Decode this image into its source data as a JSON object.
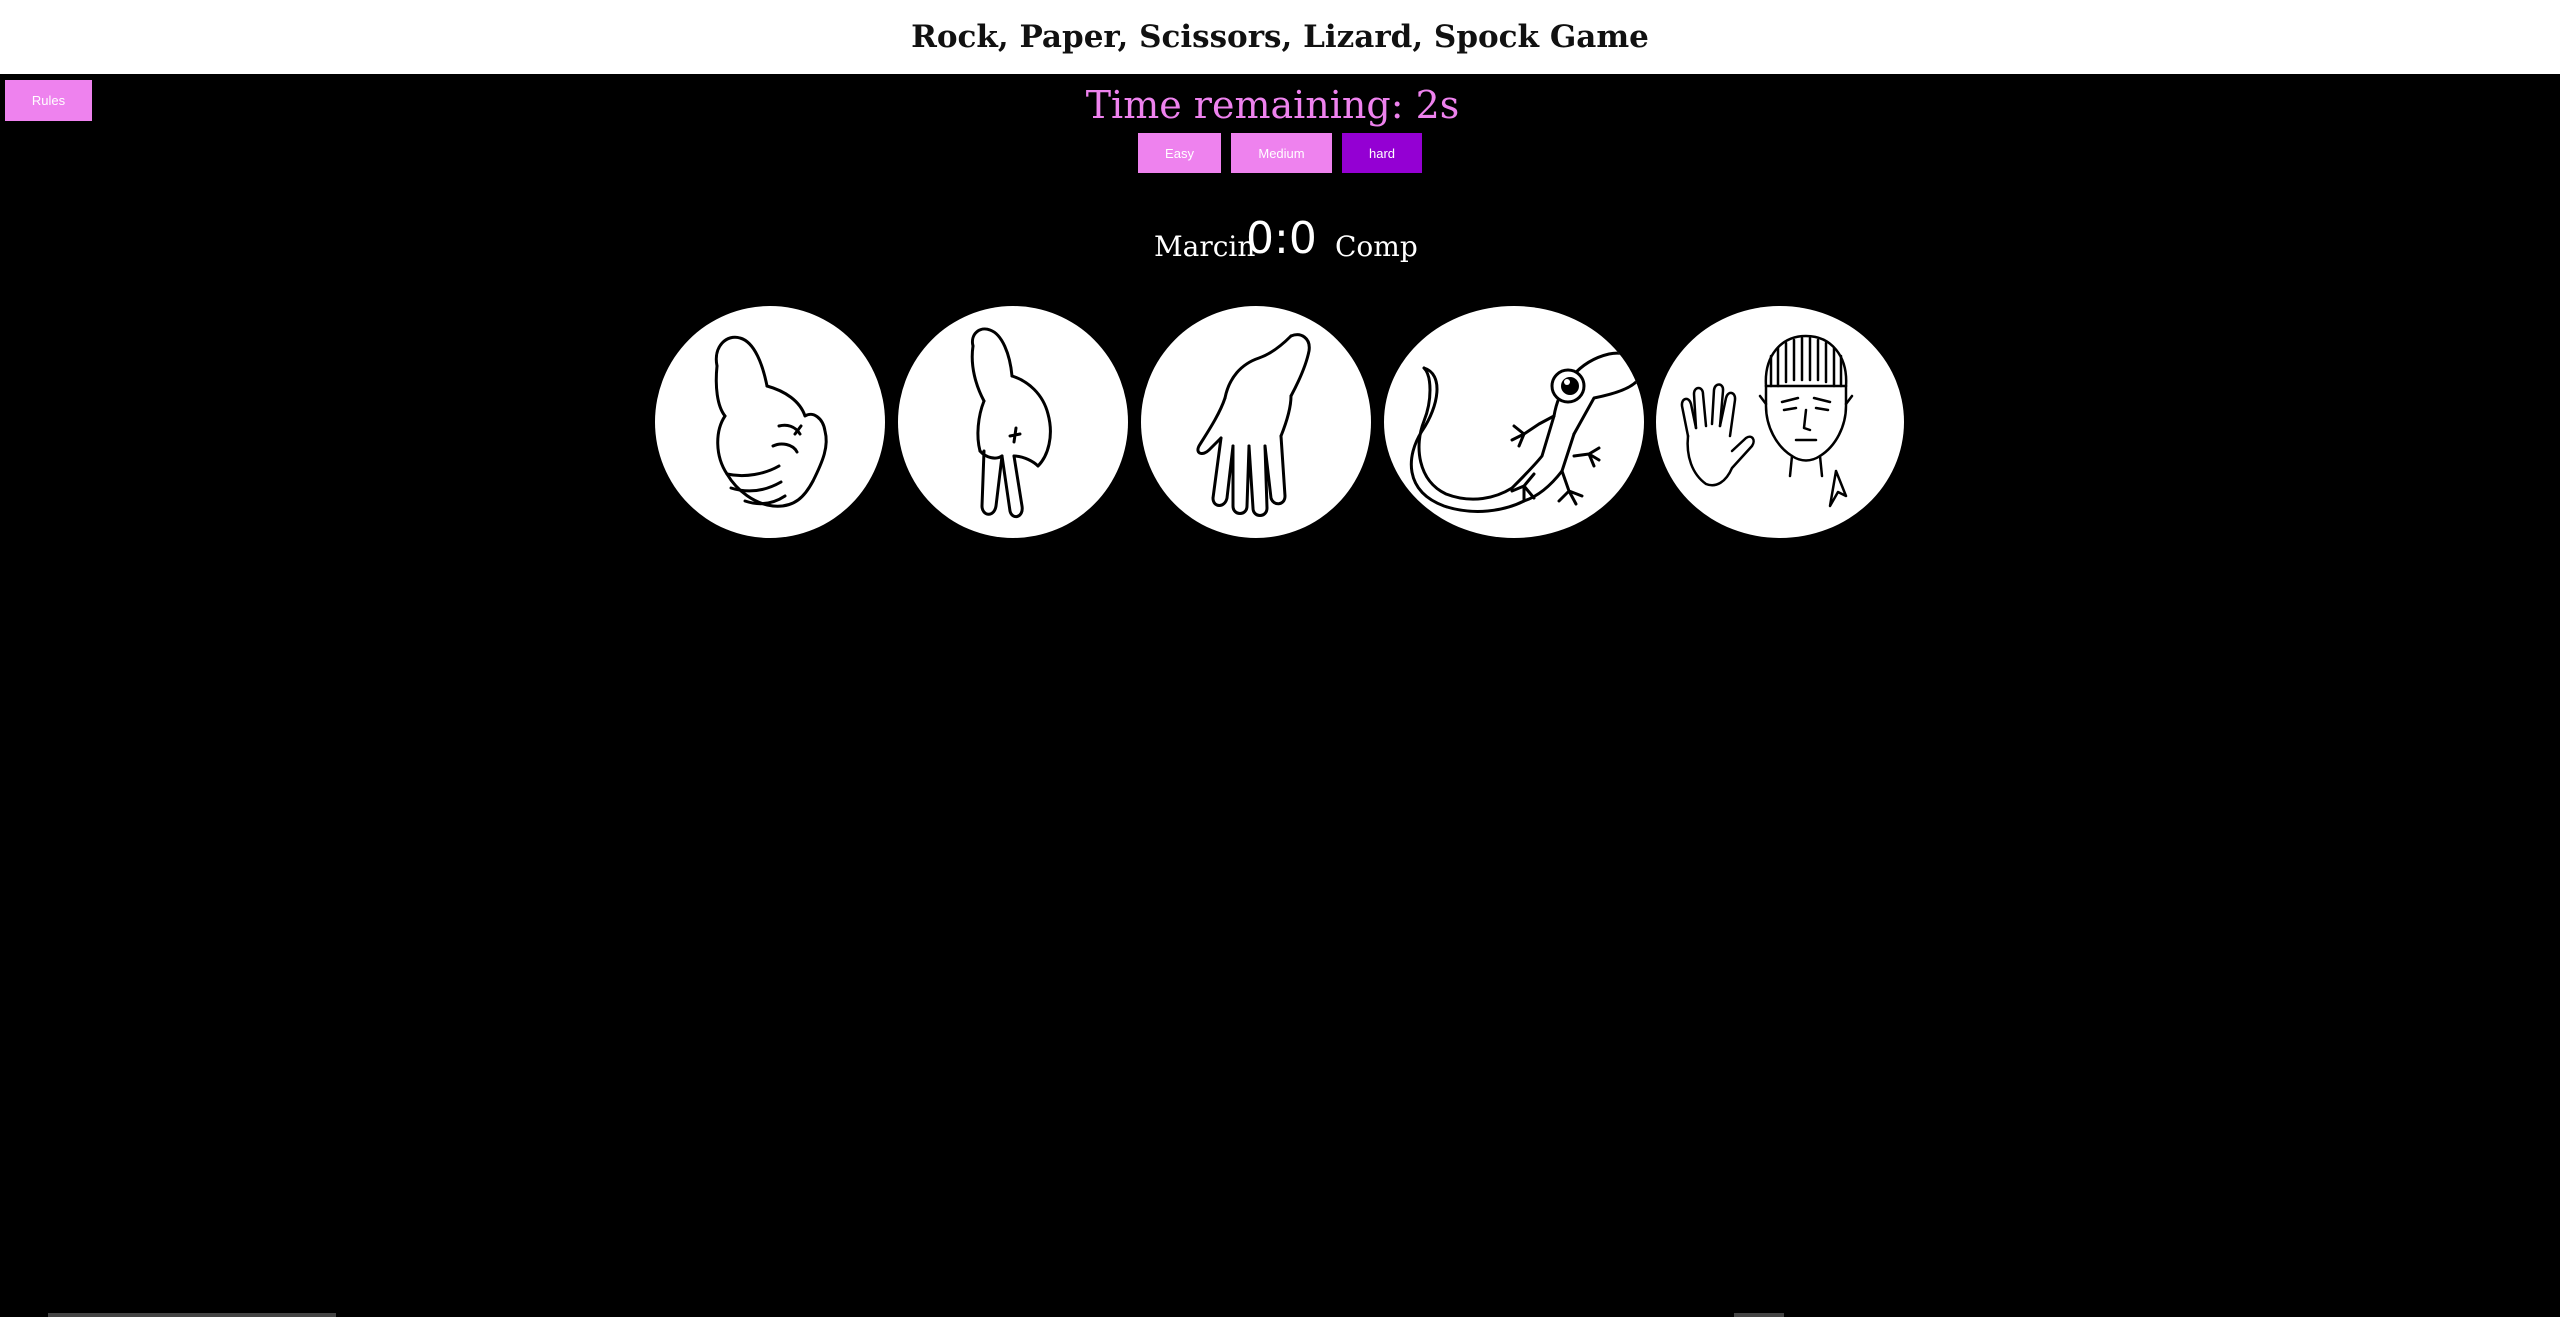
{
  "header": {
    "title": "Rock, Paper, Scissors, Lizard, Spock Game"
  },
  "rules_button": {
    "label": "Rules"
  },
  "timer": {
    "text": "Time remaining: 2s"
  },
  "difficulty": {
    "options": [
      "Easy",
      "Medium",
      "hard"
    ],
    "selected": "hard"
  },
  "scoreboard": {
    "player": "Marcin",
    "score": "0:0",
    "computer": "Comp"
  },
  "choices": [
    {
      "name": "rock",
      "icon": "rock-fist-icon"
    },
    {
      "name": "scissors",
      "icon": "scissors-hand-icon"
    },
    {
      "name": "paper",
      "icon": "paper-hand-icon"
    },
    {
      "name": "lizard",
      "icon": "lizard-icon"
    },
    {
      "name": "spock",
      "icon": "spock-icon"
    }
  ],
  "colors": {
    "background": "#000000",
    "header_bg": "#ffffff",
    "accent": "#ee82ee",
    "selected": "#9400d3"
  }
}
